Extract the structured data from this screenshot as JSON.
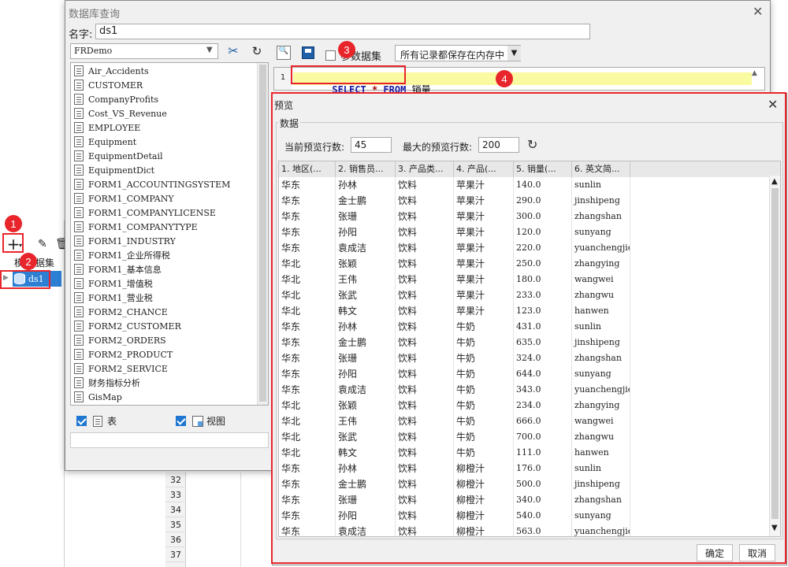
{
  "bg": {
    "row_numbers": [
      "32",
      "33",
      "34",
      "35",
      "36",
      "37"
    ],
    "left_panel_title": "模",
    "dataset_label": "数据集",
    "dataset_name": "ds1"
  },
  "query": {
    "title": "数据库查询",
    "name_label": "名字:",
    "name_value": "ds1",
    "connection": "FRDemo",
    "tables": [
      "Air_Accidents",
      "CUSTOMER",
      "CompanyProfits",
      "Cost_VS_Revenue",
      "EMPLOYEE",
      "Equipment",
      "EquipmentDetail",
      "EquipmentDict",
      "FORM1_ACCOUNTINGSYSTEM",
      "FORM1_COMPANY",
      "FORM1_COMPANYLICENSE",
      "FORM1_COMPANYTYPE",
      "FORM1_INDUSTRY",
      "FORM1_企业所得税",
      "FORM1_基本信息",
      "FORM1_增值税",
      "FORM1_营业税",
      "FORM2_CHANCE",
      "FORM2_CUSTOMER",
      "FORM2_ORDERS",
      "FORM2_PRODUCT",
      "FORM2_SERVICE",
      "财务指标分析",
      "GisMap"
    ],
    "table_check_label": "表",
    "view_check_label": "视图",
    "param_label": "参数据集",
    "cache_option": "所有记录都保存在内存中",
    "line_no": "1",
    "sql": {
      "k1": "SELECT",
      "star": "*",
      "k2": "FROM",
      "table": "销量"
    }
  },
  "preview": {
    "title": "预览",
    "group_label": "数据",
    "cur_rows_label": "当前预览行数:",
    "cur_rows": "45",
    "max_rows_label": "最大的预览行数:",
    "max_rows": "200",
    "columns": [
      "1. 地区(...",
      "2. 销售员...",
      "3. 产品类...",
      "4. 产品(...",
      "5. 销量(...",
      "6. 英文简..."
    ],
    "rows": [
      [
        "华东",
        "孙林",
        "饮料",
        "苹果汁",
        "140.0",
        "sunlin"
      ],
      [
        "华东",
        "金士鹏",
        "饮料",
        "苹果汁",
        "290.0",
        "jinshipeng"
      ],
      [
        "华东",
        "张珊",
        "饮料",
        "苹果汁",
        "300.0",
        "zhangshan"
      ],
      [
        "华东",
        "孙阳",
        "饮料",
        "苹果汁",
        "120.0",
        "sunyang"
      ],
      [
        "华东",
        "袁成洁",
        "饮料",
        "苹果汁",
        "220.0",
        "yuanchengjie"
      ],
      [
        "华北",
        "张颖",
        "饮料",
        "苹果汁",
        "250.0",
        "zhangying"
      ],
      [
        "华北",
        "王伟",
        "饮料",
        "苹果汁",
        "180.0",
        "wangwei"
      ],
      [
        "华北",
        "张武",
        "饮料",
        "苹果汁",
        "233.0",
        "zhangwu"
      ],
      [
        "华北",
        "韩文",
        "饮料",
        "苹果汁",
        "123.0",
        "hanwen"
      ],
      [
        "华东",
        "孙林",
        "饮料",
        "牛奶",
        "431.0",
        "sunlin"
      ],
      [
        "华东",
        "金士鹏",
        "饮料",
        "牛奶",
        "635.0",
        "jinshipeng"
      ],
      [
        "华东",
        "张珊",
        "饮料",
        "牛奶",
        "324.0",
        "zhangshan"
      ],
      [
        "华东",
        "孙阳",
        "饮料",
        "牛奶",
        "644.0",
        "sunyang"
      ],
      [
        "华东",
        "袁成洁",
        "饮料",
        "牛奶",
        "343.0",
        "yuanchengjie"
      ],
      [
        "华北",
        "张颖",
        "饮料",
        "牛奶",
        "234.0",
        "zhangying"
      ],
      [
        "华北",
        "王伟",
        "饮料",
        "牛奶",
        "666.0",
        "wangwei"
      ],
      [
        "华北",
        "张武",
        "饮料",
        "牛奶",
        "700.0",
        "zhangwu"
      ],
      [
        "华北",
        "韩文",
        "饮料",
        "牛奶",
        "111.0",
        "hanwen"
      ],
      [
        "华东",
        "孙林",
        "饮料",
        "柳橙汁",
        "176.0",
        "sunlin"
      ],
      [
        "华东",
        "金士鹏",
        "饮料",
        "柳橙汁",
        "500.0",
        "jinshipeng"
      ],
      [
        "华东",
        "张珊",
        "饮料",
        "柳橙汁",
        "340.0",
        "zhangshan"
      ],
      [
        "华东",
        "孙阳",
        "饮料",
        "柳橙汁",
        "540.0",
        "sunyang"
      ],
      [
        "华东",
        "袁成洁",
        "饮料",
        "柳橙汁",
        "563.0",
        "yuanchengjie"
      ]
    ],
    "ok_label": "确定",
    "cancel_label": "取消"
  },
  "badges": [
    "1",
    "2",
    "3",
    "4"
  ],
  "colors": {
    "accent": "#1f77d0",
    "annotation": "#e8252b",
    "sql_highlight": "#fafaa0",
    "keyword": "#1a1aa6"
  }
}
